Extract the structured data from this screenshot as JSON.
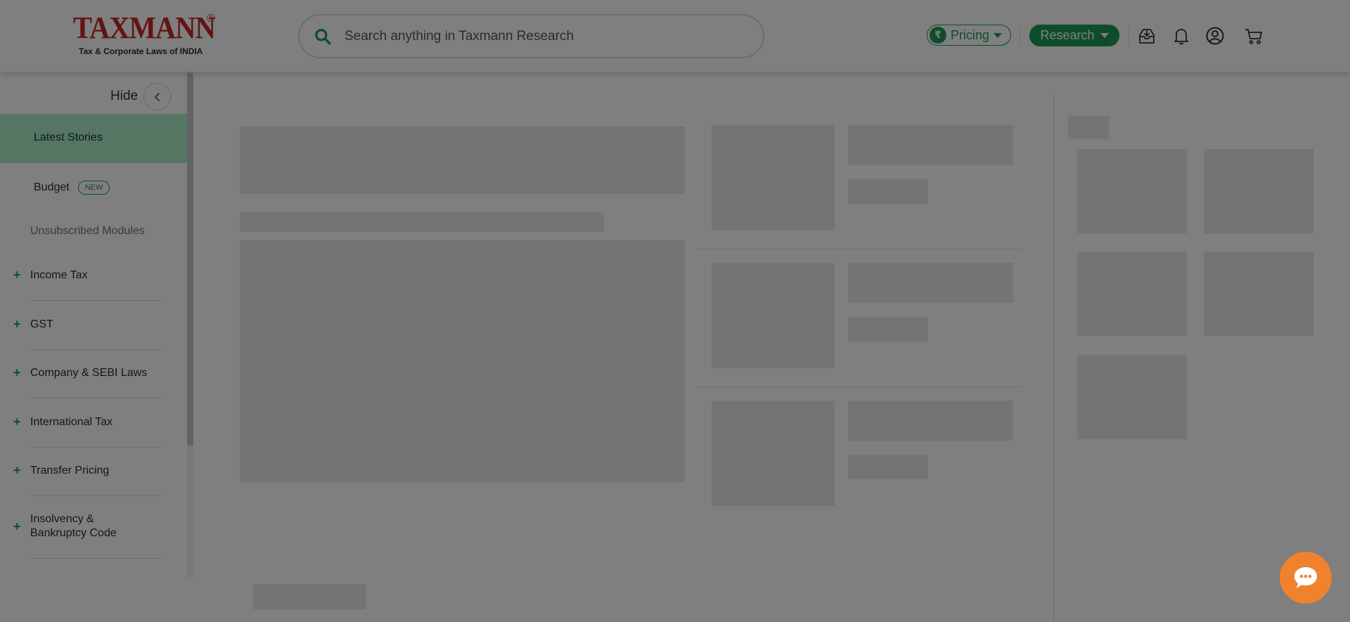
{
  "header": {
    "logo": {
      "word": "TAXMANN",
      "registered": "®",
      "tagline": "Tax & Corporate Laws of INDIA"
    },
    "search": {
      "placeholder": "Search anything in Taxmann Research"
    },
    "pricing": {
      "label": "Pricing",
      "currency_symbol": "₹"
    },
    "research": {
      "label": "Research"
    },
    "icons": [
      "download-inbox-icon",
      "bell-icon",
      "user-account-icon",
      "cart-icon"
    ]
  },
  "sidebar": {
    "hide_label": "Hide",
    "latest_stories": "Latest Stories",
    "budget": {
      "label": "Budget",
      "badge": "NEW"
    },
    "unsubscribed_heading": "Unsubscribed Modules",
    "modules": [
      {
        "label": "Income Tax"
      },
      {
        "label": "GST"
      },
      {
        "label": "Company & SEBI Laws"
      },
      {
        "label": "International Tax"
      },
      {
        "label": "Transfer Pricing"
      },
      {
        "label": "Insolvency & Bankruptcy Code"
      }
    ]
  },
  "colors": {
    "brand_red": "#c62828",
    "brand_green": "#1c9b58",
    "active_item_bg": "#a9ecc6",
    "chat_button": "#f0812d",
    "overlay": "rgba(0,0,0,0.5)"
  },
  "main": {
    "state": "loading-skeleton"
  },
  "chat": {
    "icon": "chat-bubble-icon"
  }
}
